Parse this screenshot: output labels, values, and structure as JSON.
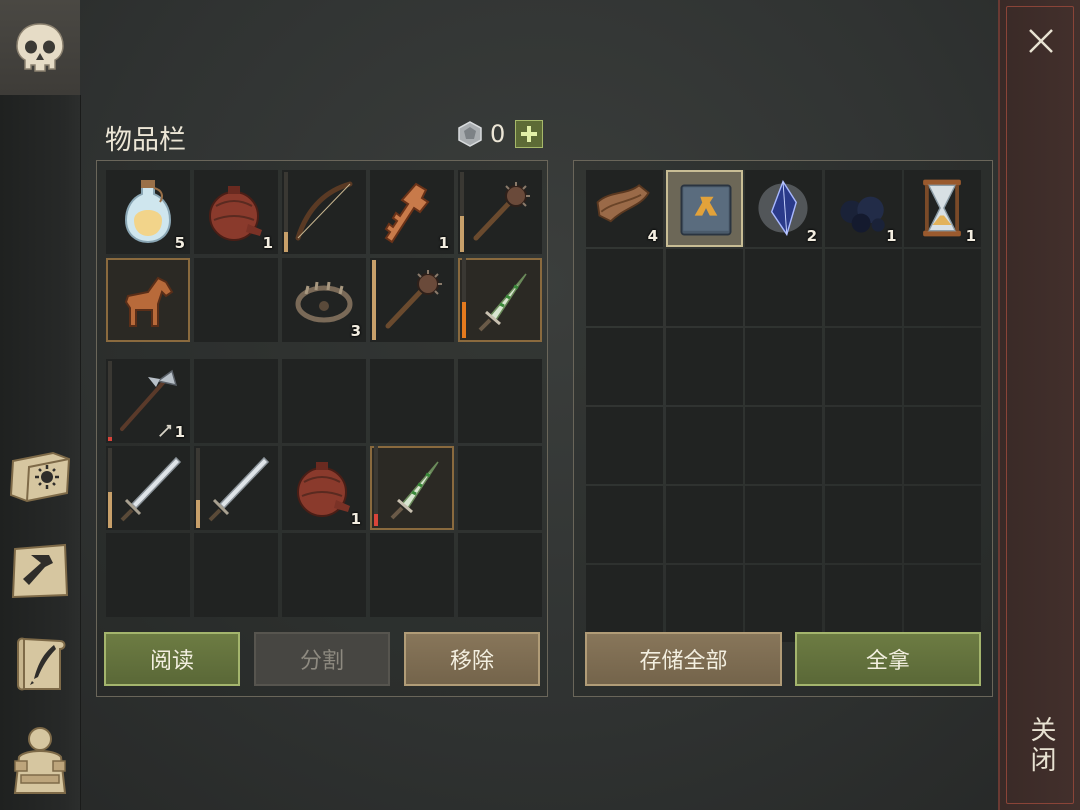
{
  "sidebar": {
    "icons": [
      "skull-icon",
      "sun-book-icon",
      "hammer-map-icon",
      "quill-scroll-icon",
      "character-icon"
    ]
  },
  "inventory": {
    "title": "物品栏",
    "currency_count": "0",
    "plus_label": "+",
    "top_slots": [
      {
        "item": "potion-bottle-icon",
        "qty": "5"
      },
      {
        "item": "leather-flask-icon",
        "qty": "1"
      },
      {
        "item": "bow-icon",
        "qty": "",
        "durability": 0.25
      },
      {
        "item": "bronze-key-icon",
        "qty": "1"
      },
      {
        "item": "spiked-mace-icon",
        "qty": "",
        "durability": 0.45
      },
      {
        "item": "wooden-horse-icon",
        "qty": "",
        "selected": true
      },
      {
        "item": "",
        "qty": ""
      },
      {
        "item": "bear-trap-icon",
        "qty": "3"
      },
      {
        "item": "spiked-mace-icon",
        "qty": "",
        "durability": 1.0
      },
      {
        "item": "poison-dagger-icon",
        "qty": "",
        "durability": 0.45,
        "selected": true
      }
    ],
    "bottom_slots": [
      {
        "item": "halberd-icon",
        "qty": "1",
        "qty_prefix": "arrow-icon",
        "durability": 0.05
      },
      {
        "item": "",
        "qty": ""
      },
      {
        "item": "",
        "qty": ""
      },
      {
        "item": "",
        "qty": ""
      },
      {
        "item": "",
        "qty": ""
      },
      {
        "item": "longsword-icon",
        "qty": "",
        "durability": 0.45
      },
      {
        "item": "longsword-icon",
        "qty": "",
        "durability": 0.35
      },
      {
        "item": "leather-flask-icon",
        "qty": "1"
      },
      {
        "item": "poison-dagger-icon",
        "qty": "",
        "durability": 0.15,
        "selected": true
      },
      {
        "item": "",
        "qty": ""
      }
    ],
    "buttons": {
      "read": "阅读",
      "split": "分割",
      "remove": "移除"
    }
  },
  "storage": {
    "slots": [
      {
        "item": "leather-scraps-icon",
        "qty": "4"
      },
      {
        "item": "blueprint-book-icon",
        "qty": "",
        "selected": true
      },
      {
        "item": "crystal-shard-icon",
        "qty": "2"
      },
      {
        "item": "coal-icon",
        "qty": "1"
      },
      {
        "item": "hourglass-icon",
        "qty": "1"
      }
    ],
    "buttons": {
      "store_all": "存储全部",
      "take_all": "全拿"
    }
  },
  "close_panel": {
    "label": "关闭"
  },
  "colors": {
    "green_button": "#6d7c43",
    "tan_button": "#88765a",
    "grey_button": "#474642",
    "durability_tan": "#c8a06a",
    "durability_orange": "#e57a1e",
    "durability_red": "#d9443a"
  }
}
